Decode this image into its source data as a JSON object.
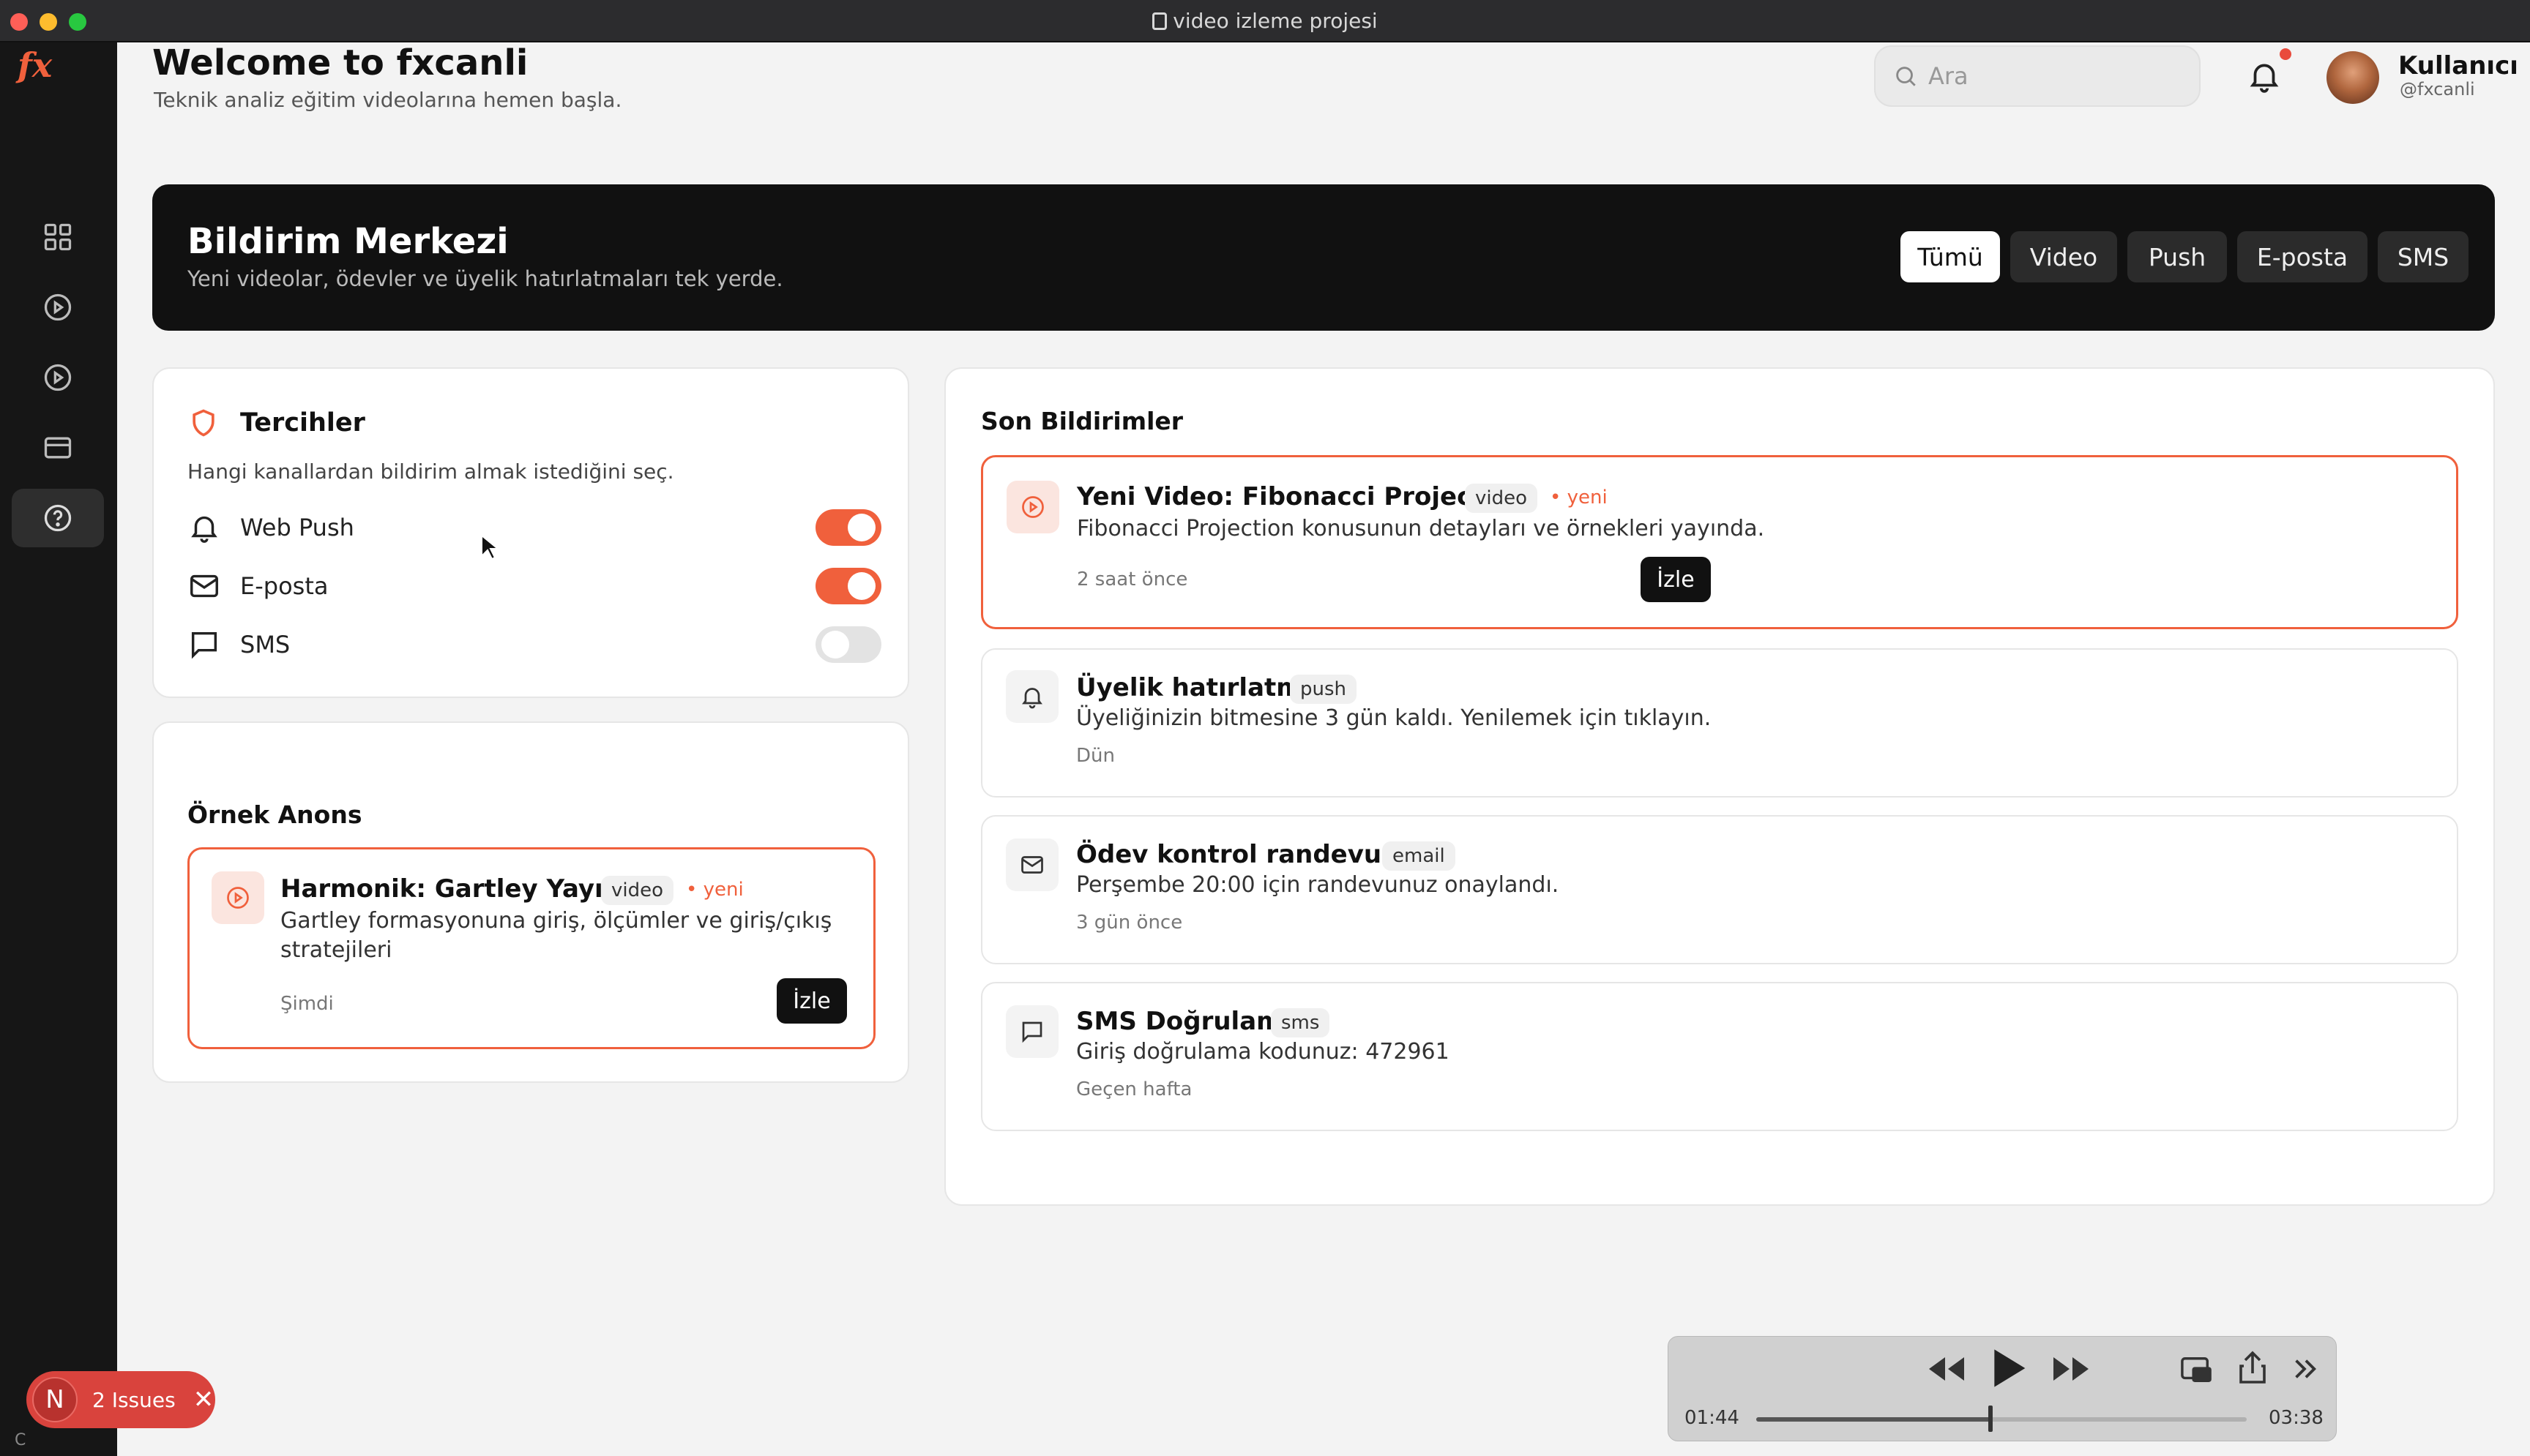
{
  "window": {
    "title": "video izleme projesi"
  },
  "brand": {
    "logo": "fx",
    "accent": "#f0603c"
  },
  "sidebar": {
    "items": [
      {
        "name": "dashboard",
        "icon": "grid-icon",
        "active": false
      },
      {
        "name": "videos",
        "icon": "play-circle-icon",
        "active": false
      },
      {
        "name": "courses",
        "icon": "play-circle-icon",
        "active": false
      },
      {
        "name": "billing",
        "icon": "credit-card-icon",
        "active": false
      },
      {
        "name": "help",
        "icon": "help-circle-icon",
        "active": true
      }
    ]
  },
  "header": {
    "title": "Welcome to fxcanli",
    "subtitle": "Teknik analiz eğitim videolarına hemen başla.",
    "search_placeholder": "Ara",
    "user": {
      "name": "Kullanıcı",
      "handle": "@fxcanli"
    }
  },
  "hero": {
    "title": "Bildirim Merkezi",
    "subtitle": "Yeni videolar, ödevler ve üyelik hatırlatmaları tek yerde.",
    "filters": [
      {
        "label": "Tümü",
        "active": true
      },
      {
        "label": "Video",
        "active": false
      },
      {
        "label": "Push",
        "active": false
      },
      {
        "label": "E-posta",
        "active": false
      },
      {
        "label": "SMS",
        "active": false
      }
    ]
  },
  "preferences": {
    "title": "Tercihler",
    "description": "Hangi kanallardan bildirim almak istediğini seç.",
    "items": [
      {
        "label": "Web Push",
        "enabled": true
      },
      {
        "label": "E-posta",
        "enabled": true
      },
      {
        "label": "SMS",
        "enabled": false
      }
    ]
  },
  "announcement": {
    "title": "Örnek Anons",
    "item": {
      "title": "Harmonik: Gartley Yayında",
      "tag": "video",
      "new_label": "• yeni",
      "description": "Gartley formasyonuna giriş, ölçümler ve giriş/çıkış stratejileri",
      "time": "Şimdi",
      "action": "İzle"
    }
  },
  "recent": {
    "title": "Son Bildirimler",
    "items": [
      {
        "title": "Yeni Video: Fibonacci Projection",
        "tag": "video",
        "new_label": "• yeni",
        "description": "Fibonacci Projection konusunun detayları ve örnekleri yayında.",
        "time": "2 saat önce",
        "action": "İzle"
      },
      {
        "title": "Üyelik hatırlatma",
        "tag": "push",
        "description": "Üyeliğinizin bitmesine 3 gün kaldı. Yenilemek için tıklayın.",
        "time": "Dün"
      },
      {
        "title": "Ödev kontrol randevusu",
        "tag": "email",
        "description": "Perşembe 20:00 için randevunuz onaylandı.",
        "time": "3 gün önce"
      },
      {
        "title": "SMS Doğrulama",
        "tag": "sms",
        "description": "Giriş doğrulama kodunuz: 472961",
        "time": "Geçen hafta"
      }
    ]
  },
  "player": {
    "current": "01:44",
    "duration": "03:38",
    "progress": 0.477
  },
  "issues": {
    "badge": "N",
    "label": "2 Issues"
  }
}
